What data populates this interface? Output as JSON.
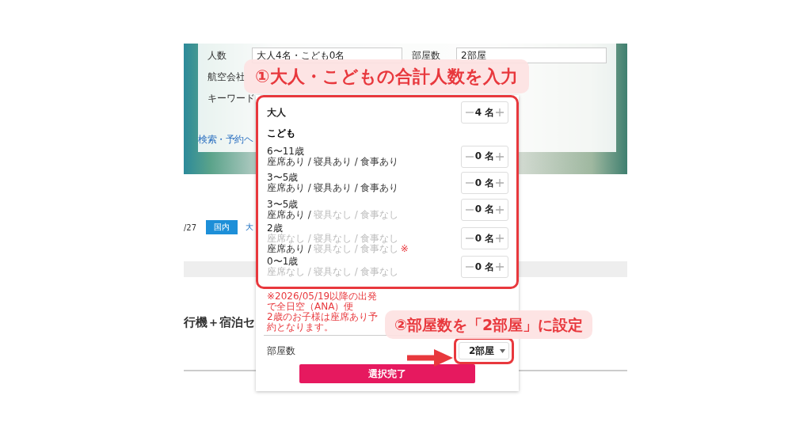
{
  "page": {
    "search_form": {
      "fields": [
        {
          "label": "人数",
          "value": "大人4名・こども0名"
        },
        {
          "label": "部屋数",
          "value": "2部屋"
        },
        {
          "label": "航空会社"
        },
        {
          "label": "キーワード"
        }
      ],
      "help_link": "検索・予約ヘ"
    },
    "date_text": "/27",
    "region_tag": "国内",
    "link_text": "大",
    "section_title": "行機＋宿泊セ"
  },
  "guest_popup": {
    "highlighted": true,
    "adult": {
      "label": "大人",
      "count": "4 名"
    },
    "child_heading": "こども",
    "children": [
      {
        "label": "6〜11歳",
        "count": "0 名",
        "lines": [
          {
            "segments": [
              {
                "text": "座席あり /",
                "available": true
              },
              {
                "text": "寝具あり /",
                "available": true
              },
              {
                "text": "食事あり",
                "available": true
              }
            ]
          }
        ]
      },
      {
        "label": "3〜5歳",
        "count": "0 名",
        "lines": [
          {
            "segments": [
              {
                "text": "座席あり /",
                "available": true
              },
              {
                "text": "寝具あり /",
                "available": true
              },
              {
                "text": "食事あり",
                "available": true
              }
            ]
          }
        ]
      },
      {
        "label": "3〜5歳",
        "count": "0 名",
        "lines": [
          {
            "segments": [
              {
                "text": "座席あり /",
                "available": true
              },
              {
                "text": "寝具なし /",
                "available": false
              },
              {
                "text": "食事なし",
                "available": false
              }
            ]
          }
        ]
      },
      {
        "label": "2歳",
        "count": "0 名",
        "lines": [
          {
            "segments": [
              {
                "text": "座席なし /",
                "available": false
              },
              {
                "text": "寝具なし /",
                "available": false
              },
              {
                "text": "食事なし",
                "available": false
              }
            ]
          },
          {
            "segments": [
              {
                "text": "座席あり /",
                "available": true
              },
              {
                "text": "寝具なし /",
                "available": false
              },
              {
                "text": "食事なし",
                "available": false
              }
            ],
            "note_mark": "※"
          }
        ]
      },
      {
        "label": "0〜1歳",
        "count": "0 名",
        "lines": [
          {
            "segments": [
              {
                "text": "座席なし /",
                "available": false
              },
              {
                "text": "寝具なし /",
                "available": false
              },
              {
                "text": "食事なし",
                "available": false
              }
            ]
          }
        ]
      }
    ],
    "notes": [
      "※2026/05/19以降の出発で全日空（ANA）便",
      "2歳のお子様は座席あり予約となります。"
    ],
    "rooms": {
      "label": "部屋数",
      "value": "2部屋",
      "highlighted": true
    },
    "confirm_button": "選択完了"
  },
  "callouts": [
    "①大人・こどもの合計人数を入力",
    "②部屋数を「2部屋」に設定"
  ]
}
